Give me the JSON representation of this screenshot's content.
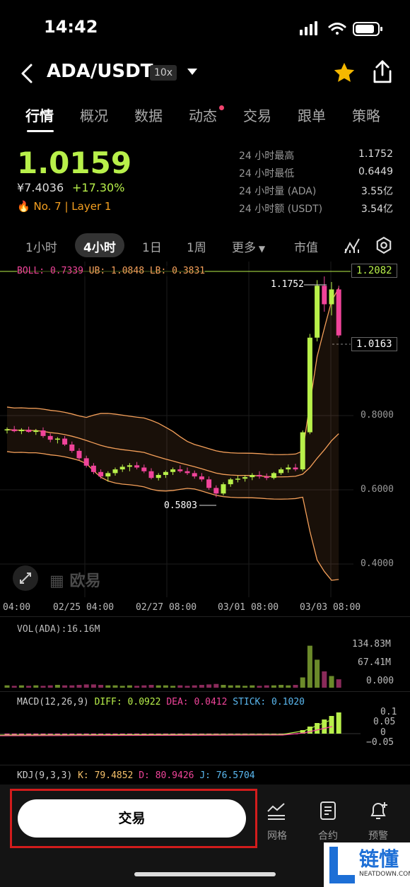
{
  "status": {
    "time": "14:42"
  },
  "header": {
    "pair": "ADA/USDT",
    "leverage": "10x"
  },
  "tabs": [
    "行情",
    "概况",
    "数据",
    "动态",
    "交易",
    "跟单",
    "策略"
  ],
  "price": {
    "last": "1.0159",
    "cny": "¥7.4036",
    "change": "+17.30%",
    "rank": "No. 7",
    "tag": "Layer 1"
  },
  "stats": [
    {
      "label": "24 小时最高",
      "value": "1.1752"
    },
    {
      "label": "24 小时最低",
      "value": "0.6449"
    },
    {
      "label": "24 小时量 (ADA)",
      "value": "3.55亿"
    },
    {
      "label": "24 小时额 (USDT)",
      "value": "3.54亿"
    }
  ],
  "timeframes": [
    "1小时",
    "4小时",
    "1日",
    "1周",
    "更多",
    "市值"
  ],
  "boll": {
    "boll": "BOLL: 0.7339",
    "ub": "UB: 1.0848",
    "lb": "LB: 0.3831"
  },
  "price_labels": {
    "top": "1.2082",
    "current": "1.0163",
    "high": "1.1752",
    "low": "0.5803",
    "p08": "0.8000",
    "p06": "0.6000",
    "p04": "0.4000"
  },
  "x_labels": [
    "04:00",
    "02/25 04:00",
    "02/27 08:00",
    "03/01 08:00",
    "03/03 08:00"
  ],
  "watermark": "欧易",
  "vol": {
    "title": "VOL(ADA):16.16M",
    "max": "134.83M",
    "mid": "67.41M",
    "min": "0.000"
  },
  "macd": {
    "title": "MACD(12,26,9)",
    "diff": "DIFF: 0.0922",
    "dea": "DEA: 0.0412",
    "stick": "STICK: 0.1020",
    "y1": "0.1",
    "y2": "0.05",
    "y3": "0",
    "y4": "−0.05"
  },
  "kdj": {
    "title": "KDJ(9,3,3)",
    "k": "K: 79.4852",
    "d": "D: 80.9426",
    "j": "J: 76.5704"
  },
  "bottom": {
    "trade": "交易",
    "grid": "网格",
    "contract": "合约",
    "alert": "预警"
  },
  "corner": {
    "brand": "链懂",
    "site": "NEATDOWN.COM"
  },
  "colors": {
    "up": "#b8f04a",
    "down": "#f0449a",
    "band": "#f5a05a",
    "accent": "#d21c1c"
  },
  "chart_data": {
    "type": "candlestick",
    "y_ticks": [
      0.8,
      0.6,
      0.4
    ],
    "ylim": [
      0.36,
      1.25
    ],
    "candles": [
      [
        0.76,
        0.768,
        0.752,
        0.763
      ],
      [
        0.763,
        0.772,
        0.755,
        0.758
      ],
      [
        0.758,
        0.766,
        0.75,
        0.762
      ],
      [
        0.762,
        0.77,
        0.754,
        0.756
      ],
      [
        0.756,
        0.764,
        0.748,
        0.76
      ],
      [
        0.76,
        0.768,
        0.74,
        0.745
      ],
      [
        0.745,
        0.752,
        0.728,
        0.735
      ],
      [
        0.735,
        0.742,
        0.725,
        0.738
      ],
      [
        0.738,
        0.745,
        0.718,
        0.722
      ],
      [
        0.722,
        0.73,
        0.7,
        0.705
      ],
      [
        0.705,
        0.712,
        0.68,
        0.685
      ],
      [
        0.685,
        0.692,
        0.66,
        0.665
      ],
      [
        0.665,
        0.672,
        0.642,
        0.648
      ],
      [
        0.648,
        0.655,
        0.63,
        0.636
      ],
      [
        0.636,
        0.65,
        0.622,
        0.645
      ],
      [
        0.645,
        0.66,
        0.638,
        0.655
      ],
      [
        0.655,
        0.668,
        0.648,
        0.662
      ],
      [
        0.662,
        0.672,
        0.65,
        0.666
      ],
      [
        0.666,
        0.675,
        0.655,
        0.66
      ],
      [
        0.66,
        0.668,
        0.645,
        0.65
      ],
      [
        0.65,
        0.658,
        0.628,
        0.632
      ],
      [
        0.632,
        0.645,
        0.625,
        0.64
      ],
      [
        0.64,
        0.652,
        0.632,
        0.648
      ],
      [
        0.648,
        0.66,
        0.64,
        0.655
      ],
      [
        0.655,
        0.666,
        0.646,
        0.65
      ],
      [
        0.65,
        0.66,
        0.64,
        0.645
      ],
      [
        0.645,
        0.652,
        0.63,
        0.636
      ],
      [
        0.636,
        0.645,
        0.622,
        0.628
      ],
      [
        0.628,
        0.636,
        0.6,
        0.605
      ],
      [
        0.605,
        0.612,
        0.58,
        0.59
      ],
      [
        0.59,
        0.62,
        0.585,
        0.615
      ],
      [
        0.615,
        0.632,
        0.608,
        0.628
      ],
      [
        0.628,
        0.638,
        0.62,
        0.63
      ],
      [
        0.63,
        0.64,
        0.622,
        0.634
      ],
      [
        0.634,
        0.645,
        0.626,
        0.64
      ],
      [
        0.64,
        0.65,
        0.63,
        0.636
      ],
      [
        0.636,
        0.644,
        0.626,
        0.632
      ],
      [
        0.632,
        0.648,
        0.628,
        0.645
      ],
      [
        0.645,
        0.66,
        0.64,
        0.655
      ],
      [
        0.655,
        0.668,
        0.646,
        0.66
      ],
      [
        0.66,
        0.67,
        0.65,
        0.655
      ],
      [
        0.655,
        0.76,
        0.65,
        0.755
      ],
      [
        0.755,
        1.02,
        0.75,
        1.01
      ],
      [
        1.01,
        1.165,
        1.0,
        1.15
      ],
      [
        1.15,
        1.175,
        1.08,
        1.1
      ],
      [
        1.1,
        1.16,
        1.07,
        1.14
      ],
      [
        1.14,
        1.15,
        1.01,
        1.016
      ]
    ],
    "volume_rel": [
      0.05,
      0.04,
      0.05,
      0.04,
      0.05,
      0.04,
      0.05,
      0.06,
      0.05,
      0.05,
      0.06,
      0.07,
      0.07,
      0.06,
      0.05,
      0.05,
      0.04,
      0.05,
      0.04,
      0.05,
      0.06,
      0.05,
      0.05,
      0.04,
      0.05,
      0.04,
      0.05,
      0.06,
      0.07,
      0.08,
      0.06,
      0.05,
      0.05,
      0.04,
      0.05,
      0.04,
      0.05,
      0.05,
      0.06,
      0.05,
      0.06,
      0.22,
      0.9,
      0.6,
      0.35,
      0.25,
      0.18
    ]
  }
}
